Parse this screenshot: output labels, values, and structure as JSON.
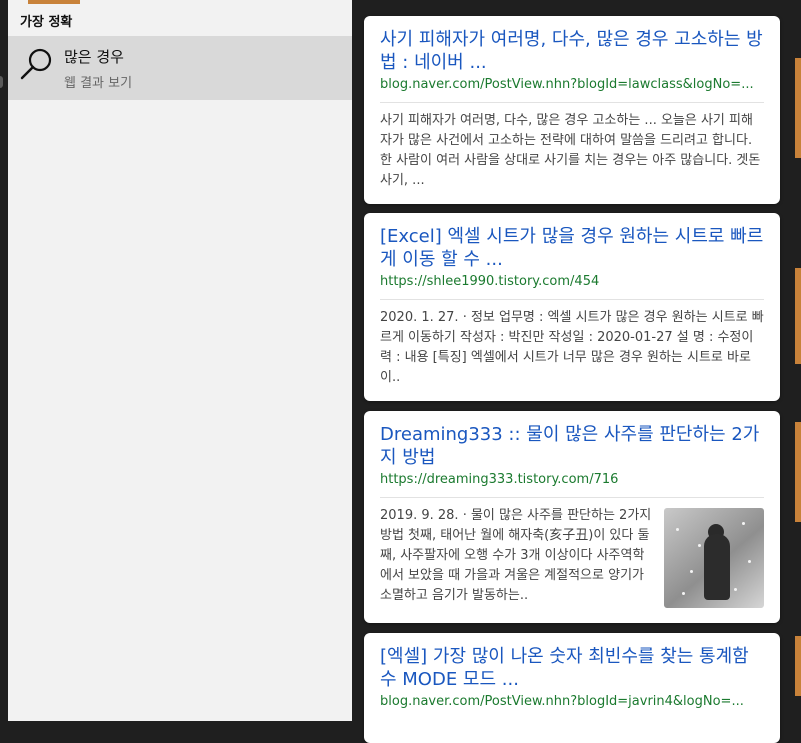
{
  "left": {
    "section_header": "가장 정확",
    "best_match": {
      "title": "많은 경우",
      "subtitle": "웹 결과 보기",
      "icon": "search-icon"
    }
  },
  "results": [
    {
      "title": "사기 피해자가 여러명, 다수, 많은 경우 고소하는 방법 : 네이버 ...",
      "url": "blog.naver.com/PostView.nhn?blogId=lawclass&logNo=...",
      "snippet": "사기 피해자가 여러명, 다수, 많은 경우 고소하는 ... 오늘은 사기 피해자가 많은 사건에서 고소하는 전략에 대하여 말씀을 드리려고 합니다. 한 사람이 여러 사람을 상대로 사기를 치는 경우는 아주 많습니다. 겟돈 사기, ..."
    },
    {
      "title": "[Excel] 엑셀 시트가 많을 경우 원하는 시트로 빠르게 이동 할 수 ...",
      "url": "https://shlee1990.tistory.com/454",
      "snippet": "2020. 1. 27. · 정보 업무명 : 엑셀 시트가 많은 경우 원하는 시트로 빠르게 이동하기 작성자 : 박진만 작성일 : 2020-01-27 설 명 : 수정이력 : 내용 [특징] 엑셀에서 시트가 너무 많은 경우 원하는 시트로 바로 이.."
    },
    {
      "title": "Dreaming333 :: 물이 많은 사주를 판단하는 2가지 방법",
      "url": "https://dreaming333.tistory.com/716",
      "snippet": "2019. 9. 28. · 물이 많은 사주를 판단하는 2가지 방법 첫째, 태어난 월에 해자축(亥子丑)이 있다 둘째, 사주팔자에 오행 수가 3개 이상이다 사주역학에서 보았을 때 가을과 겨울은 계절적으로 양기가 소멸하고 음기가 발동하는.."
    },
    {
      "title": "[엑셀] 가장 많이 나온 숫자 최빈수를 찾는 통계함수 MODE 모드 ...",
      "url": "blog.naver.com/PostView.nhn?blogId=javrin4&logNo=..."
    }
  ],
  "colors": {
    "accent": "#c8823a",
    "link": "#1a57bf",
    "url": "#1b7a2f"
  }
}
